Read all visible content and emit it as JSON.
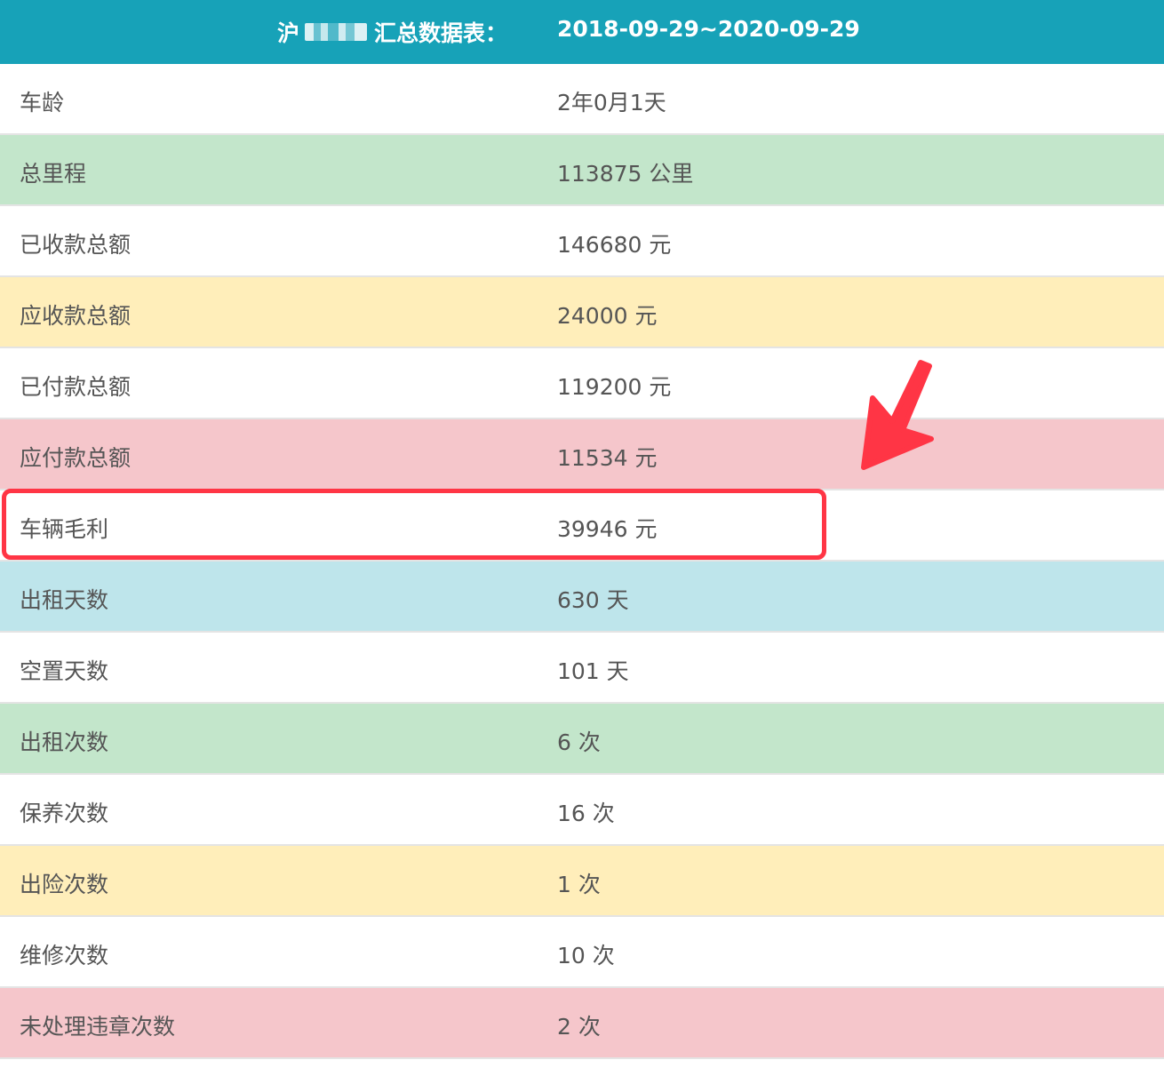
{
  "header": {
    "title_prefix": "沪",
    "title_suffix": "汇总数据表：",
    "date_range": "2018-09-29~2020-09-29"
  },
  "rows": [
    {
      "label": "车龄",
      "value": "2年0月1天",
      "color": "#ffffff"
    },
    {
      "label": "总里程",
      "value": "113875 公里",
      "color": "#c3e6cb"
    },
    {
      "label": "已收款总额",
      "value": "146680 元",
      "color": "#ffffff"
    },
    {
      "label": "应收款总额",
      "value": "24000 元",
      "color": "#ffeeba"
    },
    {
      "label": "已付款总额",
      "value": "119200 元",
      "color": "#ffffff"
    },
    {
      "label": "应付款总额",
      "value": "11534 元",
      "color": "#f5c6cb"
    },
    {
      "label": "车辆毛利",
      "value": "39946 元",
      "color": "#ffffff"
    },
    {
      "label": "出租天数",
      "value": "630 天",
      "color": "#bee5eb"
    },
    {
      "label": "空置天数",
      "value": "101 天",
      "color": "#ffffff"
    },
    {
      "label": "出租次数",
      "value": "6 次",
      "color": "#c3e6cb"
    },
    {
      "label": "保养次数",
      "value": "16 次",
      "color": "#ffffff"
    },
    {
      "label": "出险次数",
      "value": "1 次",
      "color": "#ffeeba"
    },
    {
      "label": "维修次数",
      "value": "10 次",
      "color": "#ffffff"
    },
    {
      "label": "未处理违章次数",
      "value": "2 次",
      "color": "#f5c6cb"
    }
  ],
  "annotation": {
    "highlight_color": "#ff3545",
    "highlighted_row": "车辆毛利"
  },
  "colors": {
    "header_bg": "#17a2b8",
    "text": "#555555"
  }
}
